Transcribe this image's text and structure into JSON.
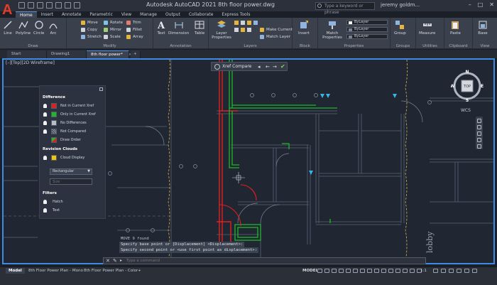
{
  "titlebar": {
    "logo": "A",
    "title": "Autodesk AutoCAD 2021   8th floor power.dwg",
    "search_placeholder": "Type a keyword or phrase",
    "user": "jeremy goldm...",
    "minimize": "–",
    "maximize": "□",
    "close": "✕"
  },
  "ribbon_tabs": [
    "Home",
    "Insert",
    "Annotate",
    "Parametric",
    "View",
    "Manage",
    "Output",
    "Collaborate",
    "Express Tools"
  ],
  "ribbon": {
    "draw": {
      "label": "Draw",
      "line": "Line",
      "polyline": "Polyline",
      "circle": "Circle",
      "arc": "Arc"
    },
    "modify": {
      "label": "Modify",
      "move": "Move",
      "rotate": "Rotate",
      "trim": "Trim",
      "copy": "Copy",
      "mirror": "Mirror",
      "fillet": "Fillet",
      "stretch": "Stretch",
      "scale": "Scale",
      "array": "Array"
    },
    "annotation": {
      "label": "Annotation",
      "text": "Text",
      "dimension": "Dimension",
      "table": "Table"
    },
    "layers": {
      "label": "Layers",
      "layer_properties": "Layer Properties",
      "make_current": "Make Current",
      "match_layer": "Match Layer"
    },
    "block": {
      "label": "Block",
      "insert": "Insert"
    },
    "properties": {
      "label": "Properties",
      "match_properties": "Match Properties",
      "bylayer1": "ByLayer",
      "bylayer2": "ByLayer",
      "bylayer3": "ByLayer"
    },
    "groups": {
      "label": "Groups",
      "group": "Group"
    },
    "utilities": {
      "label": "Utilities",
      "measure": "Measure"
    },
    "clipboard": {
      "label": "Clipboard",
      "paste": "Paste"
    },
    "view": {
      "label": "View",
      "base": "Base"
    }
  },
  "doc_tabs": {
    "start": "Start",
    "drawing1": "Drawing1",
    "active": "8th floor power*",
    "close": "×",
    "add": "+"
  },
  "viewport": {
    "label": "[–][Top][2D Wireframe]",
    "xref_compare": "Xref Compare",
    "cube_top": "TOP",
    "n": "N",
    "e": "E",
    "s": "S",
    "w": "W",
    "wcs": "WCS",
    "room_text": "lobby"
  },
  "compare_panel": {
    "difference_heading": "Difference",
    "items": [
      {
        "label": "Not in Current Xref",
        "color": "#e02020"
      },
      {
        "label": "Only in Current Xref",
        "color": "#1fb82a"
      },
      {
        "label": "No Differences",
        "color": "#b8bcc4"
      },
      {
        "label": "Not Compared",
        "color": "#9aa0aa"
      },
      {
        "label": "Draw Order",
        "color": "#1fb82a"
      }
    ],
    "revision_heading": "Revision Clouds",
    "cloud_display": "Cloud Display",
    "cloud_color": "#f5c400",
    "shape": "Rectangular",
    "size": "Size",
    "filters_heading": "Filters",
    "hatch": "Hatch",
    "text": "Text"
  },
  "command": {
    "history": [
      "MOVE 9 found",
      "Specify base point or [Displacement] <Displacement>:",
      "Specify second point or <use first point as displacement>:"
    ],
    "placeholder": "Type a command"
  },
  "status": {
    "layout_tabs": [
      "Model",
      "8th Floor Power Plan - Mono",
      "8th Floor Power Plan - Color"
    ],
    "add": "+",
    "model": "MODEL",
    "scale": "1:1"
  },
  "colors": {
    "accent_blue": "#3f8be4",
    "diff_red": "#e02020",
    "diff_green": "#1fb82a",
    "cloud_yellow": "#f5c400"
  }
}
